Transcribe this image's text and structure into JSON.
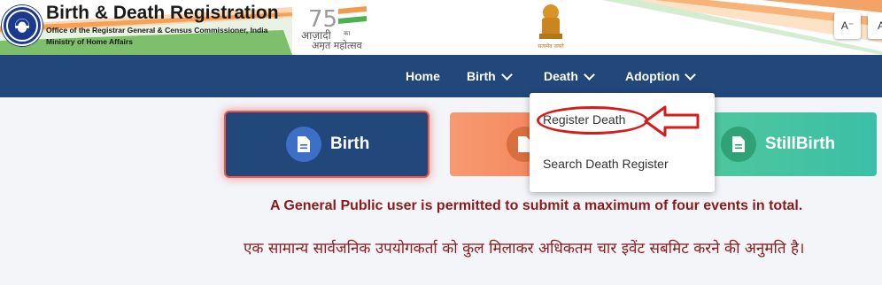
{
  "header": {
    "title": "Birth & Death Registration",
    "subtitle1": "Office of the Registrar General & Census Commissioner, India",
    "subtitle2": "Ministry of Home Affairs",
    "azadi_number": "75",
    "azadi_line1": "आज़ादी",
    "azadi_line1_small": "का",
    "azadi_line2": "अमृत महोत्सव",
    "emblem_caption": "सत्यमेव जयते",
    "font_decrease_label": "A⁻",
    "font_normal_label": "A"
  },
  "nav": {
    "home": "Home",
    "birth": "Birth",
    "death": "Death",
    "adoption": "Adoption"
  },
  "cards": {
    "birth": "Birth",
    "stillbirth": "StillBirth"
  },
  "dropdown": {
    "register_death": "Register Death",
    "search_death": "Search Death Register"
  },
  "notice": {
    "english": "A General Public user is permitted to submit a maximum of four events in total.",
    "hindi": "एक सामान्य सार्वजनिक उपयोगकर्ता को कुल मिलाकर अधिकतम चार इवेंट सबमिट करने की अनुमति है।"
  },
  "colors": {
    "navbar": "#22477b",
    "card_birth": "#22477b",
    "card_death": "#f5845a",
    "card_stillbirth": "#3bbfa6",
    "notice_text": "#8b1a1a",
    "annotation_red": "#d71a1a"
  },
  "icons": {
    "document": "document-icon",
    "chevron": "chevron-down-icon",
    "annotation": "red-arrow-annotation"
  }
}
